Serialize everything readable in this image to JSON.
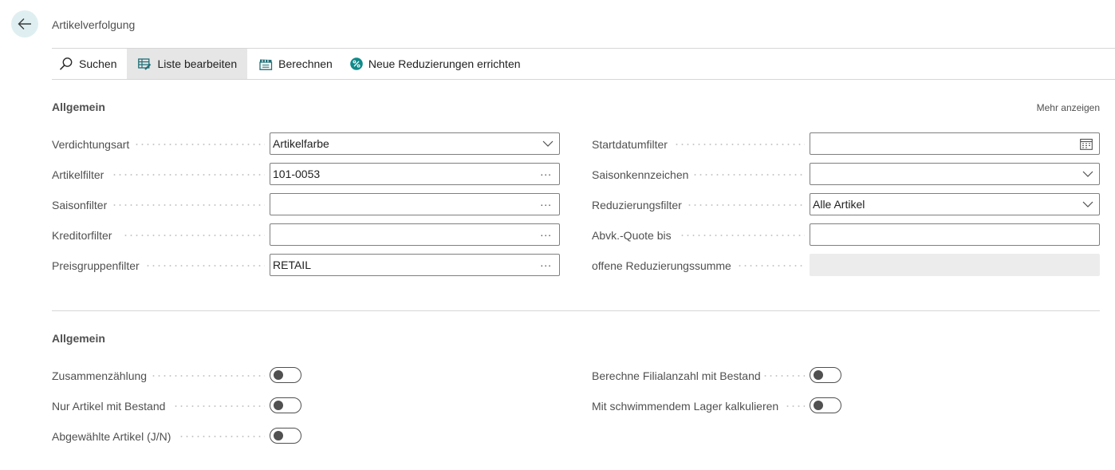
{
  "page": {
    "title": "Artikelverfolgung"
  },
  "actions": {
    "search": "Suchen",
    "edit_list": "Liste bearbeiten",
    "calculate": "Berechnen",
    "new_reductions": "Neue Reduzierungen errichten"
  },
  "section1": {
    "title": "Allgemein",
    "more_link": "Mehr anzeigen",
    "left": [
      {
        "label": "Verdichtungsart",
        "value": "Artikelfarbe",
        "kind": "dropdown"
      },
      {
        "label": "Artikelfilter",
        "value": "101-0053",
        "kind": "lookup"
      },
      {
        "label": "Saisonfilter",
        "value": "",
        "kind": "lookup"
      },
      {
        "label": "Kreditorfilter",
        "value": "",
        "kind": "lookup"
      },
      {
        "label": "Preisgruppenfilter",
        "value": "RETAIL",
        "kind": "lookup"
      }
    ],
    "right": [
      {
        "label": "Startdatumfilter",
        "value": "",
        "kind": "date"
      },
      {
        "label": "Saisonkennzeichen",
        "value": "",
        "kind": "dropdown"
      },
      {
        "label": "Reduzierungsfilter",
        "value": "Alle Artikel",
        "kind": "dropdown"
      },
      {
        "label": "Abvk.-Quote bis",
        "value": "",
        "kind": "text"
      },
      {
        "label": "offene Reduzierungssumme",
        "value": "",
        "kind": "readonly"
      }
    ]
  },
  "section2": {
    "title": "Allgemein",
    "left": [
      {
        "label": "Zusammenzählung",
        "on": false
      },
      {
        "label": "Nur Artikel mit Bestand",
        "on": false
      },
      {
        "label": "Abgewählte Artikel (J/N)",
        "on": false
      }
    ],
    "right": [
      {
        "label": "Berechne Filialanzahl mit Bestand",
        "on": false
      },
      {
        "label": "Mit schwimmendem Lager kalkulieren",
        "on": false
      }
    ]
  },
  "colors": {
    "accent": "#00838f",
    "back_button_bg": "#dfeff1",
    "active_action_bg": "#e6e6e6"
  },
  "icons": {
    "back": "arrow-left-icon",
    "search": "search-icon",
    "edit_list": "edit-list-icon",
    "calculate": "calculate-icon",
    "new_reductions": "percent-icon",
    "dropdown": "chevron-down-icon",
    "lookup": "ellipsis-icon",
    "date": "calendar-icon"
  }
}
